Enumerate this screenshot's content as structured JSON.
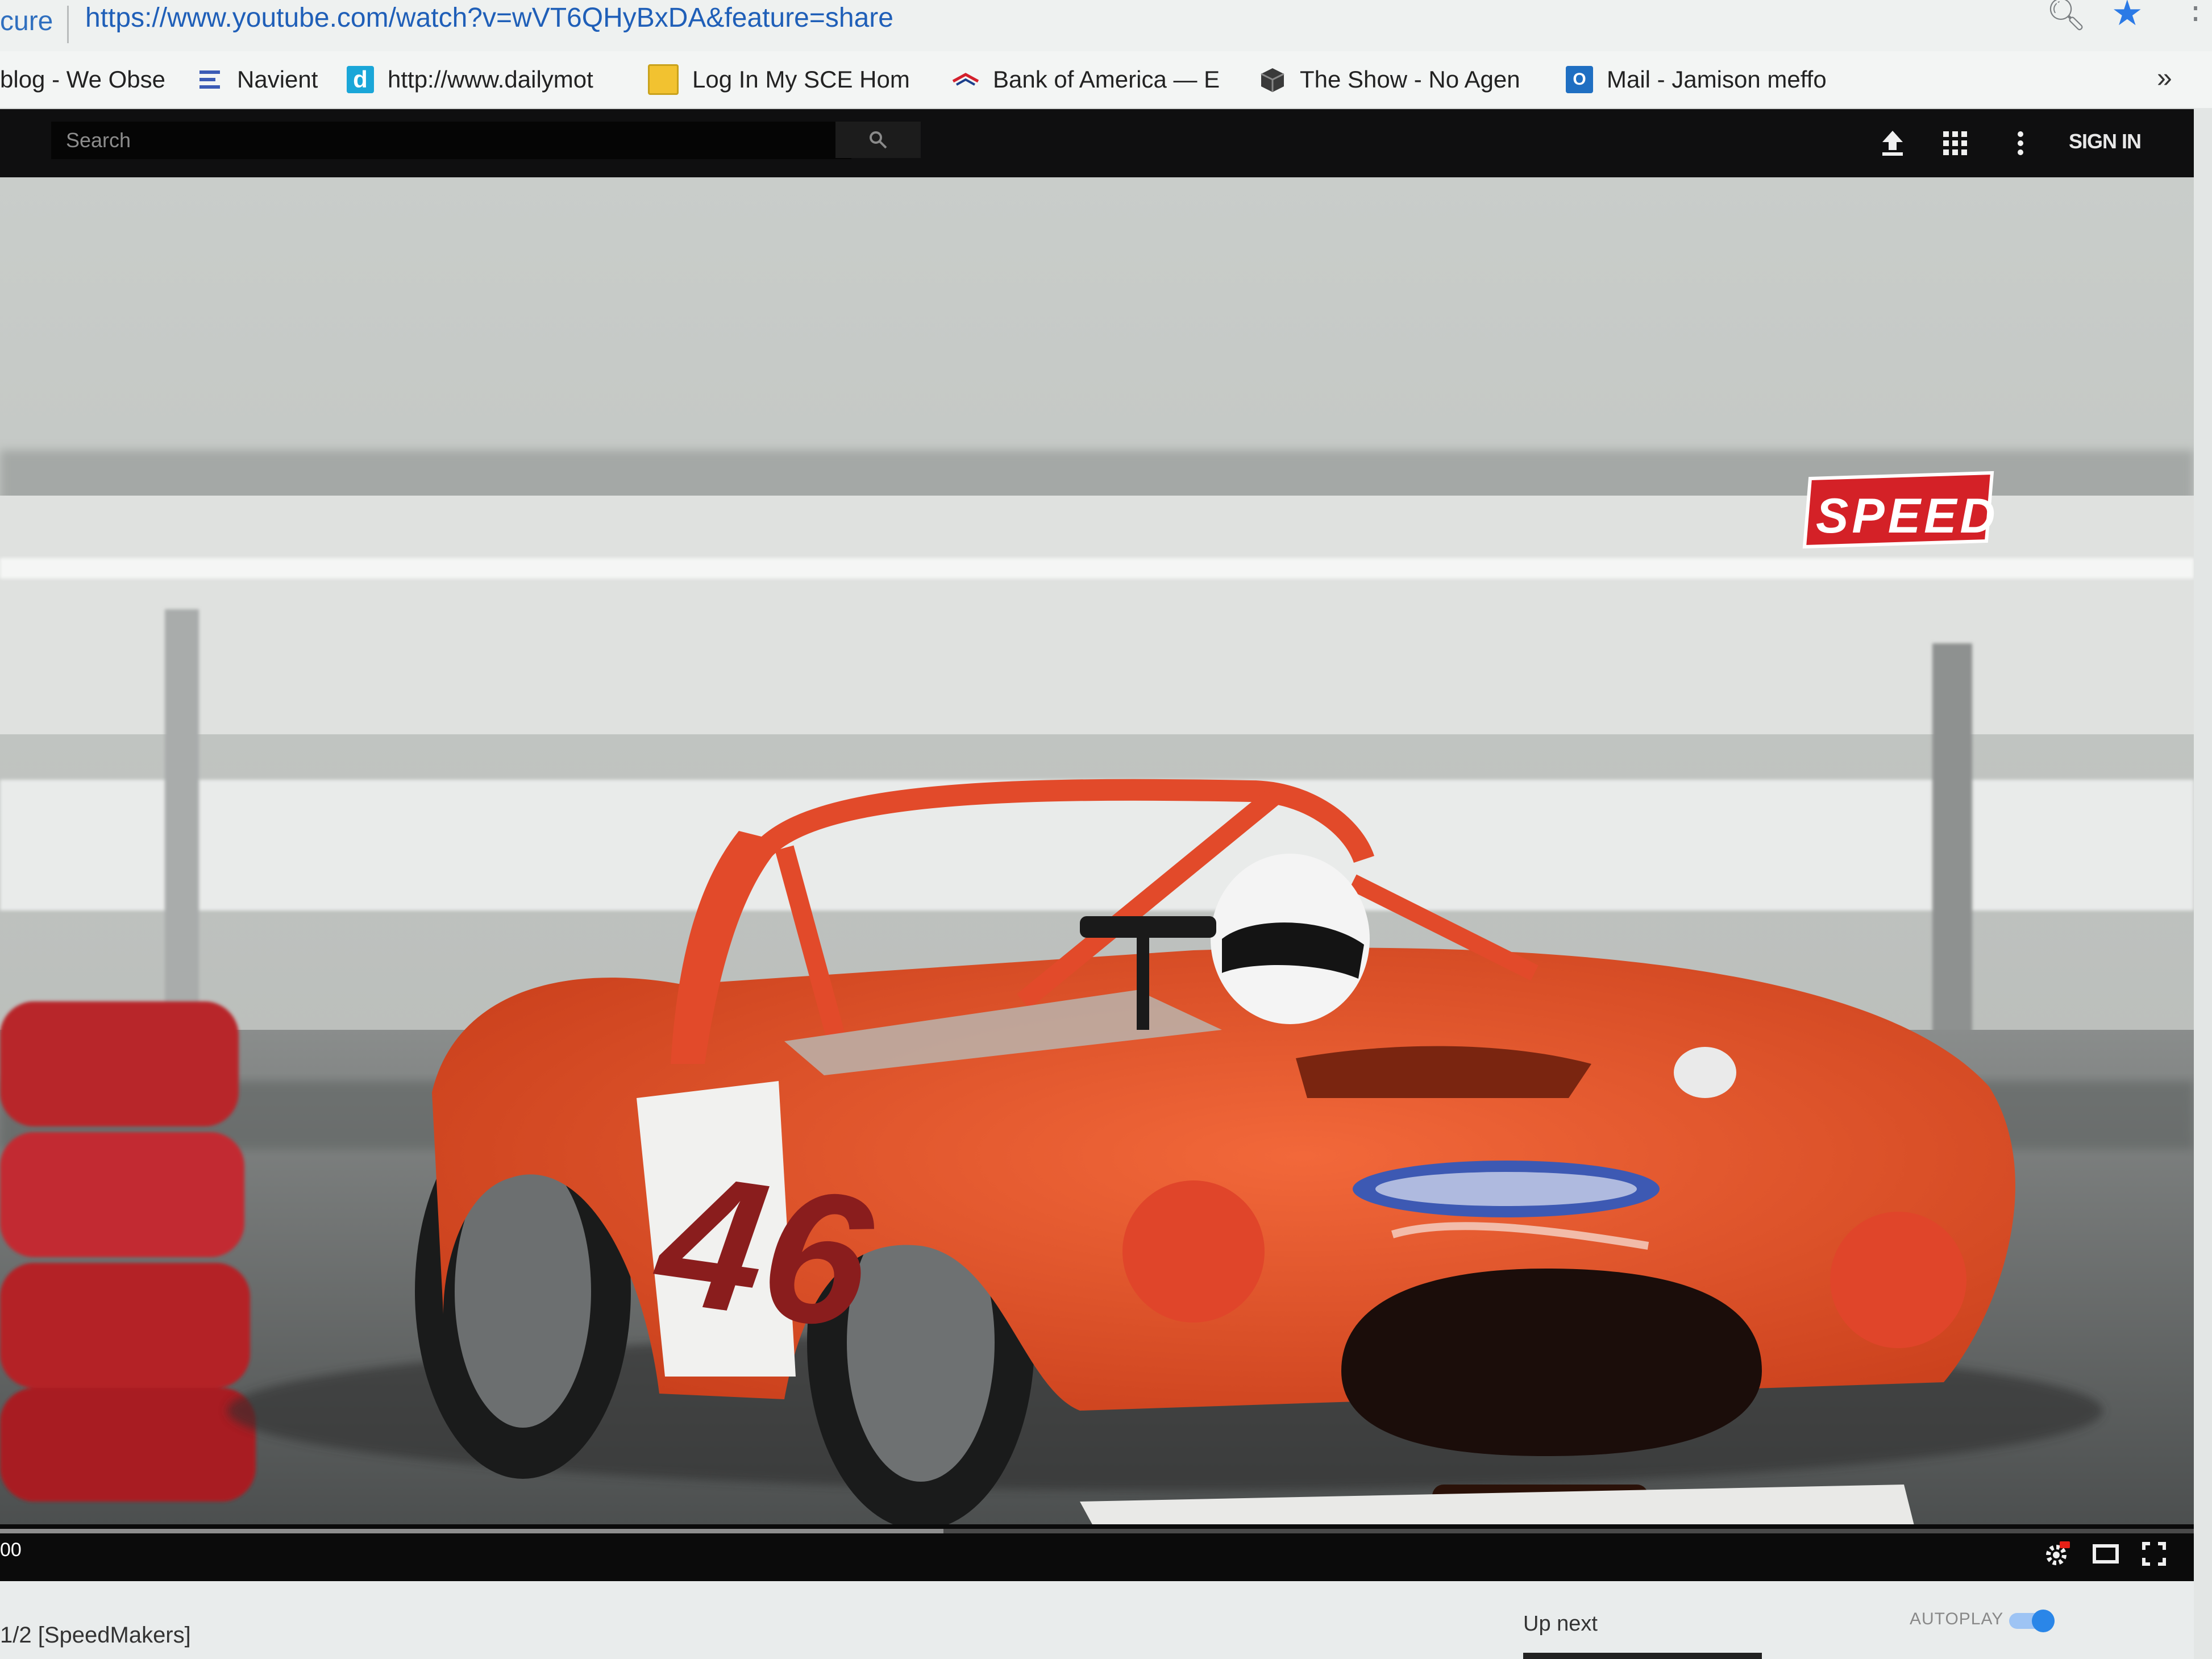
{
  "browser": {
    "url_security": "cure",
    "url": "https://www.youtube.com/watch?v=wVT6QHyBxDA&feature=share",
    "bookmarks": [
      {
        "label": "blog - We Obse",
        "icon": "none"
      },
      {
        "label": "Navient",
        "icon": "navient-icon",
        "color": "#3b5bb5"
      },
      {
        "label": "http://www.dailymot",
        "icon": "dailymotion-icon",
        "color": "#1aa6d8"
      },
      {
        "label": "Log In  My SCE  Hom",
        "icon": "sce-icon",
        "color": "#f2c230"
      },
      {
        "label": "Bank of America — E",
        "icon": "bofa-icon",
        "color": "#d4202c"
      },
      {
        "label": "The Show - No Agen",
        "icon": "cube-icon",
        "color": "#333333"
      },
      {
        "label": "Mail - Jamison meffo",
        "icon": "outlook-icon",
        "color": "#1f6fc2"
      }
    ],
    "overflow": "»"
  },
  "masthead": {
    "search_placeholder": "Search",
    "sign_in": "SIGN IN",
    "icons": [
      "upload-icon",
      "apps-grid-icon",
      "more-vert-icon"
    ]
  },
  "player": {
    "logo_text": "SPEED",
    "car_number": "46",
    "time": "00",
    "progress_loaded": 0.43,
    "controls": [
      "settings-hd-icon",
      "theater-mode-icon",
      "fullscreen-icon"
    ]
  },
  "below": {
    "title": "1/2 [SpeedMakers]",
    "up_next": "Up next",
    "autoplay": "AUTOPLAY",
    "autoplay_on": true
  },
  "colors": {
    "car_orange": "#e8532a",
    "speed_red": "#d42127",
    "masthead_bg": "#0f0f10",
    "autoplay_blue": "#2a86e8"
  }
}
